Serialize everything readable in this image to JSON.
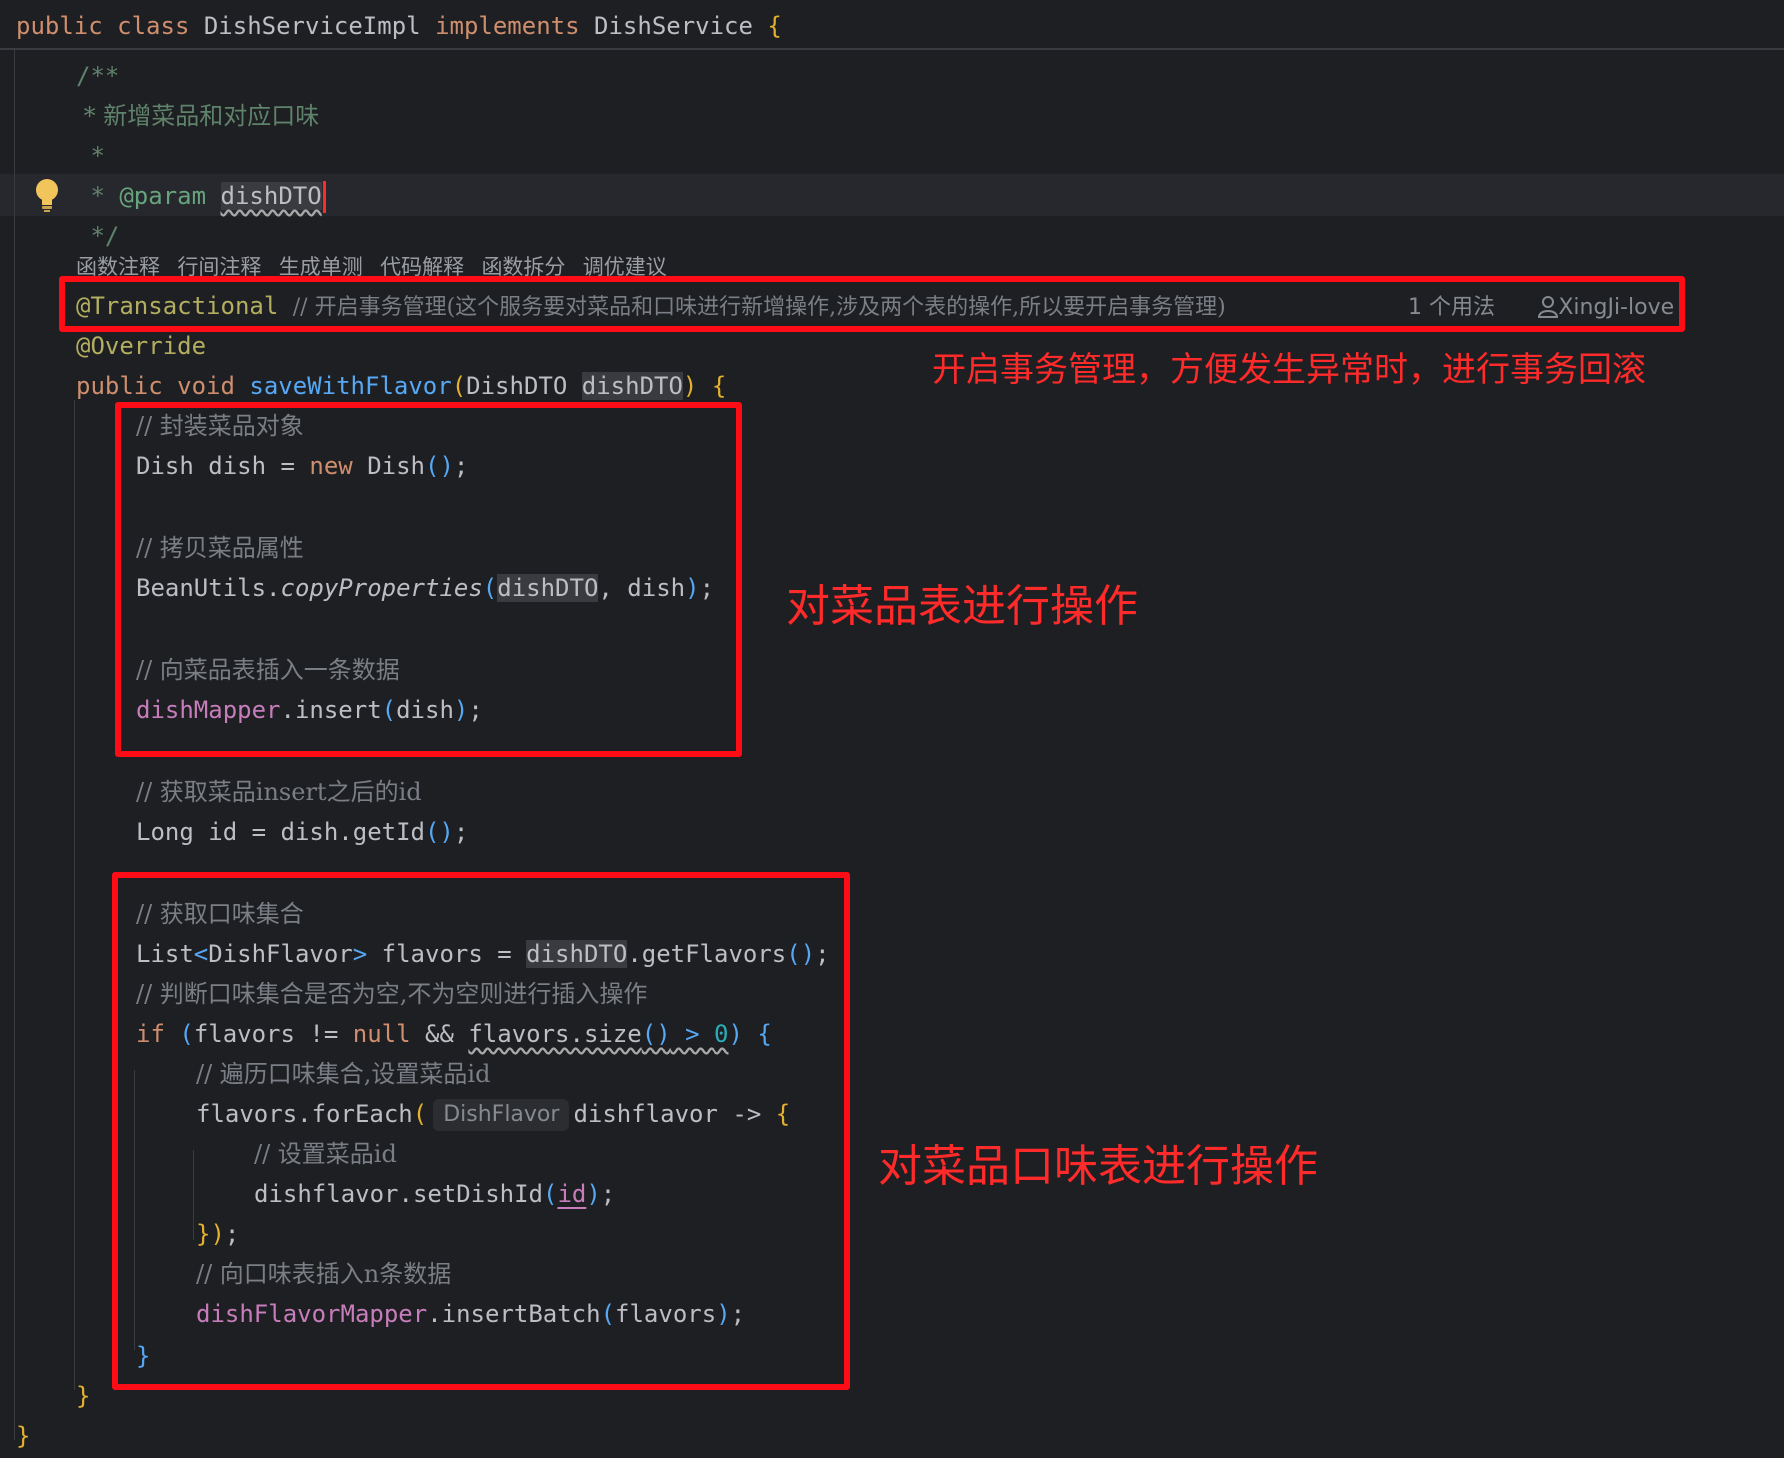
{
  "code": {
    "class_decl": {
      "public": "public",
      "class": "class",
      "name": "DishServiceImpl",
      "implements": "implements",
      "iface": "DishService",
      "brace": "{"
    },
    "doc": {
      "open": "/**",
      "line1": " * 新增菜品和对应口味",
      "line2": " *",
      "star": " * ",
      "param_tag": "@param",
      "param_name": "dishDTO",
      "close": " */"
    },
    "code_vision": {
      "items": [
        "函数注释",
        "行间注释",
        "生成单测",
        "代码解释",
        "函数拆分",
        "调优建议"
      ]
    },
    "transactional": {
      "annotation": "@Transactional",
      "comment": "// 开启事务管理(这个服务要对菜品和口味进行新增操作,涉及两个表的操作,所以要开启事务管理)",
      "usages": "1 个用法",
      "author": "XingJi-love"
    },
    "override": "@Override",
    "method_decl": {
      "public": "public",
      "void": "void",
      "name": "saveWithFlavor",
      "paren_open": "(",
      "param_type": "DishDTO",
      "param_name": "dishDTO",
      "paren_close": ")",
      "brace": "{"
    },
    "block1": {
      "c1": "// 封装菜品对象",
      "l1_type": "Dish dish = ",
      "l1_new": "new",
      "l1_ctor": " Dish",
      "l1_parens": "()",
      "l1_semi": ";",
      "c2": "// 拷贝菜品属性",
      "l2_obj": "BeanUtils.",
      "l2_method": "copyProperties",
      "l2_po": "(",
      "l2_arg1": "dishDTO",
      "l2_rest": ", dish",
      "l2_pc": ")",
      "l2_semi": ";",
      "c3": "// 向菜品表插入一条数据",
      "l3_field": "dishMapper",
      "l3_call": ".insert",
      "l3_po": "(",
      "l3_arg": "dish",
      "l3_pc": ")",
      "l3_semi": ";"
    },
    "mid": {
      "c1": "// 获取菜品insert之后的id",
      "l1_a": "Long id = dish.getId",
      "l1_parens": "()",
      "l1_semi": ";"
    },
    "block2": {
      "c1": "// 获取口味集合",
      "l1_a": "List",
      "l1_lt": "<",
      "l1_gen": "DishFlavor",
      "l1_gt": ">",
      "l1_b": " flavors = ",
      "l1_arg": "dishDTO",
      "l1_c": ".getFlavors",
      "l1_parens": "()",
      "l1_semi": ";",
      "c2": "// 判断口味集合是否为空,不为空则进行插入操作",
      "if_kw": "if",
      "if_po": " (",
      "if_a": "flavors != ",
      "if_null": "null",
      "if_and": " && ",
      "if_size": "flavors.size",
      "if_sp": "()",
      "if_gt": " > ",
      "if_num": "0",
      "if_pc": ")",
      "if_brace": " {",
      "c3": "// 遍历口味集合,设置菜品id",
      "fe_a": "flavors.forEach",
      "fe_po": "(",
      "fe_hint": "DishFlavor",
      "fe_b": "dishflavor -> ",
      "fe_brace": "{",
      "c4": "// 设置菜品id",
      "set_a": "dishflavor.setDishId",
      "set_po": "(",
      "set_id": "id",
      "set_pc": ")",
      "set_semi": ";",
      "close_lambda_b": "}",
      "close_lambda_p": ")",
      "close_lambda_s": ";",
      "c5": "// 向口味表插入n条数据",
      "ins_field": "dishFlavorMapper",
      "ins_call": ".insertBatch",
      "ins_po": "(",
      "ins_arg": "flavors",
      "ins_pc": ")",
      "ins_semi": ";",
      "close_if": "}"
    },
    "close_method": "}",
    "close_class": "}"
  },
  "notes": {
    "transaction": "开启事务管理，方便发生异常时，进行事务回滚",
    "dish_table": "对菜品表进行操作",
    "flavor_table": "对菜品口味表进行操作"
  },
  "colors": {
    "background": "#1e1f22",
    "keyword": "#cf8e6d",
    "function": "#56a8f5",
    "comment": "#7a7e85",
    "annotation": "#b3ae60",
    "field": "#c77dbb",
    "number": "#2aacb8",
    "highlight_box": "#ff0c16"
  },
  "icons": [
    "lightbulb-icon",
    "user-icon"
  ]
}
